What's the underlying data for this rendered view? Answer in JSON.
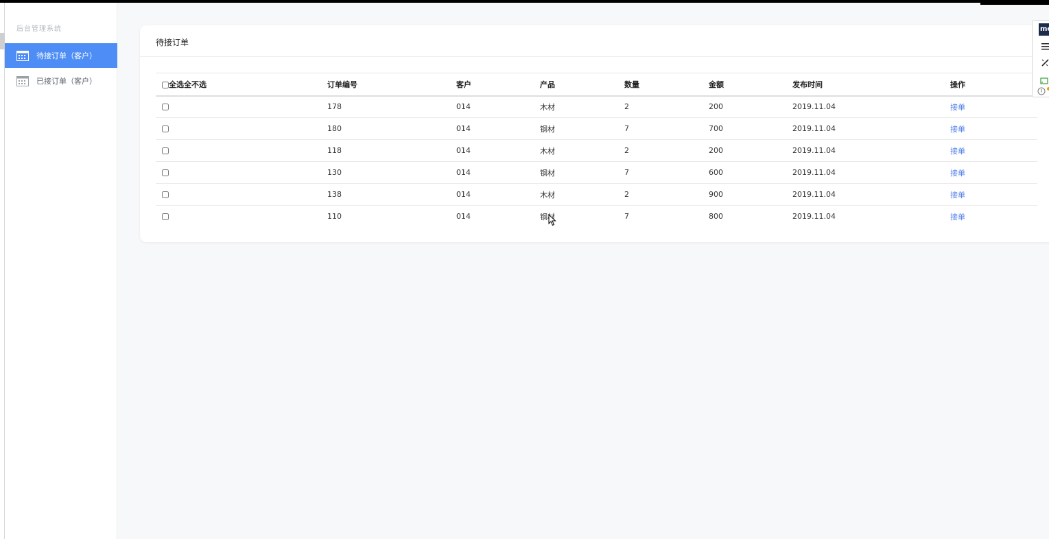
{
  "sidebar": {
    "title": "后台管理系统",
    "items": [
      {
        "label": "待接订单（客户）",
        "icon": "calendar-icon",
        "active": true
      },
      {
        "label": "已接订单（客户）",
        "icon": "calendar-icon",
        "active": false
      }
    ]
  },
  "main": {
    "title": "待接订单",
    "table": {
      "headers": [
        "全选全不选",
        "订单编号",
        "客户",
        "产品",
        "数量",
        "金额",
        "发布时间",
        "操作"
      ],
      "rows": [
        {
          "order_no": "178",
          "customer": "014",
          "product": "木材",
          "quantity": "2",
          "amount": "200",
          "date": "2019.11.04",
          "action": "接单"
        },
        {
          "order_no": "180",
          "customer": "014",
          "product": "钢材",
          "quantity": "7",
          "amount": "700",
          "date": "2019.11.04",
          "action": "接单"
        },
        {
          "order_no": "118",
          "customer": "014",
          "product": "木材",
          "quantity": "2",
          "amount": "200",
          "date": "2019.11.04",
          "action": "接单"
        },
        {
          "order_no": "130",
          "customer": "014",
          "product": "钢材",
          "quantity": "7",
          "amount": "600",
          "date": "2019.11.04",
          "action": "接单"
        },
        {
          "order_no": "138",
          "customer": "014",
          "product": "木材",
          "quantity": "2",
          "amount": "900",
          "date": "2019.11.04",
          "action": "接单"
        },
        {
          "order_no": "110",
          "customer": "014",
          "product": "钢材",
          "quantity": "7",
          "amount": "800",
          "date": "2019.11.04",
          "action": "接单"
        }
      ]
    }
  },
  "extension": {
    "logo_text": "me",
    "icons": [
      "menu-icon",
      "magic-wand-icon",
      "cast-icon",
      "info-icon"
    ]
  },
  "colors": {
    "accent": "#4d8df5",
    "link": "#4d7be8",
    "background": "#f7f8fa"
  }
}
